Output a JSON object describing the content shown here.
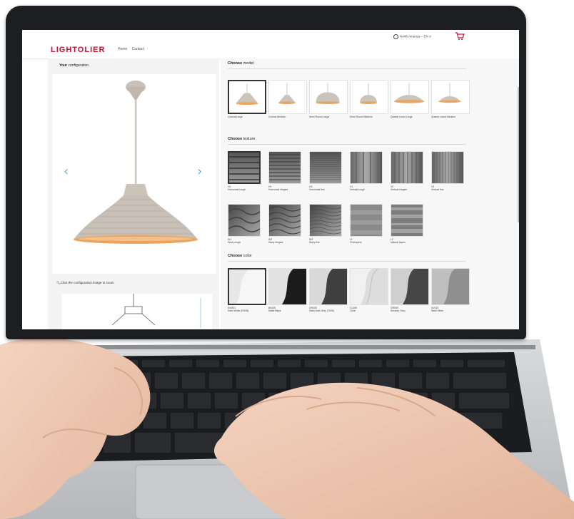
{
  "site": {
    "brand": "LIGHTOLIER",
    "nav": [
      "Home",
      "Contact"
    ],
    "region": "North America – EN ∨"
  },
  "config": {
    "title_bold": "Your",
    "title_rest": " configuration",
    "zoom_hint": "Click the configuration image to zoom",
    "prev_arrow": "‹",
    "next_arrow": "›"
  },
  "model": {
    "title_bold": "Choose",
    "title_rest": " model",
    "items": [
      {
        "label": "Conical Large",
        "selected": true
      },
      {
        "label": "Conical Medium",
        "selected": false
      },
      {
        "label": "Semi Round Large",
        "selected": false
      },
      {
        "label": "Semi Round Medium",
        "selected": false
      },
      {
        "label": "Quarter round Large",
        "selected": false
      },
      {
        "label": "Quarter round Medium",
        "selected": false
      }
    ]
  },
  "texture": {
    "title_bold": "Choose",
    "title_rest": " texture",
    "items": [
      {
        "code": "H1",
        "label": "Horizontal rough",
        "selected": true
      },
      {
        "code": "H2",
        "label": "Horizontal elegant",
        "selected": false
      },
      {
        "code": "H3",
        "label": "Horizontal fine",
        "selected": false
      },
      {
        "code": "V1",
        "label": "Vertical rough",
        "selected": false
      },
      {
        "code": "V2",
        "label": "Vertical elegant",
        "selected": false
      },
      {
        "code": "V3",
        "label": "Vertical fine",
        "selected": false
      },
      {
        "code": "W1",
        "label": "Wavy rough",
        "selected": false
      },
      {
        "code": "W2",
        "label": "Wavy elegant",
        "selected": false
      },
      {
        "code": "W3",
        "label": "Wavy fine",
        "selected": false
      },
      {
        "code": "L1",
        "label": "Find layers",
        "selected": false
      },
      {
        "code": "L2",
        "label": "Natural layers",
        "selected": false
      }
    ]
  },
  "color": {
    "title_bold": "Choose",
    "title_rest": " color",
    "items": [
      {
        "code": "SW401",
        "label": "Satin White (RG06)",
        "selected": true
      },
      {
        "code": "BK405",
        "label": "Matte Black",
        "selected": false
      },
      {
        "code": "GR405",
        "label": "Satin Dark Grey (7005)",
        "selected": false
      },
      {
        "code": "CL005",
        "label": "Clear",
        "selected": false
      },
      {
        "code": "GR005",
        "label": "Smokey Grey",
        "selected": false
      },
      {
        "code": "SV410",
        "label": "Satin Silver",
        "selected": false
      }
    ]
  },
  "colors": {
    "brand": "#c8102e",
    "lamp": "#cfc8bf",
    "lamp_inner": "#e9a560",
    "arrow": "#6fa8dc"
  }
}
